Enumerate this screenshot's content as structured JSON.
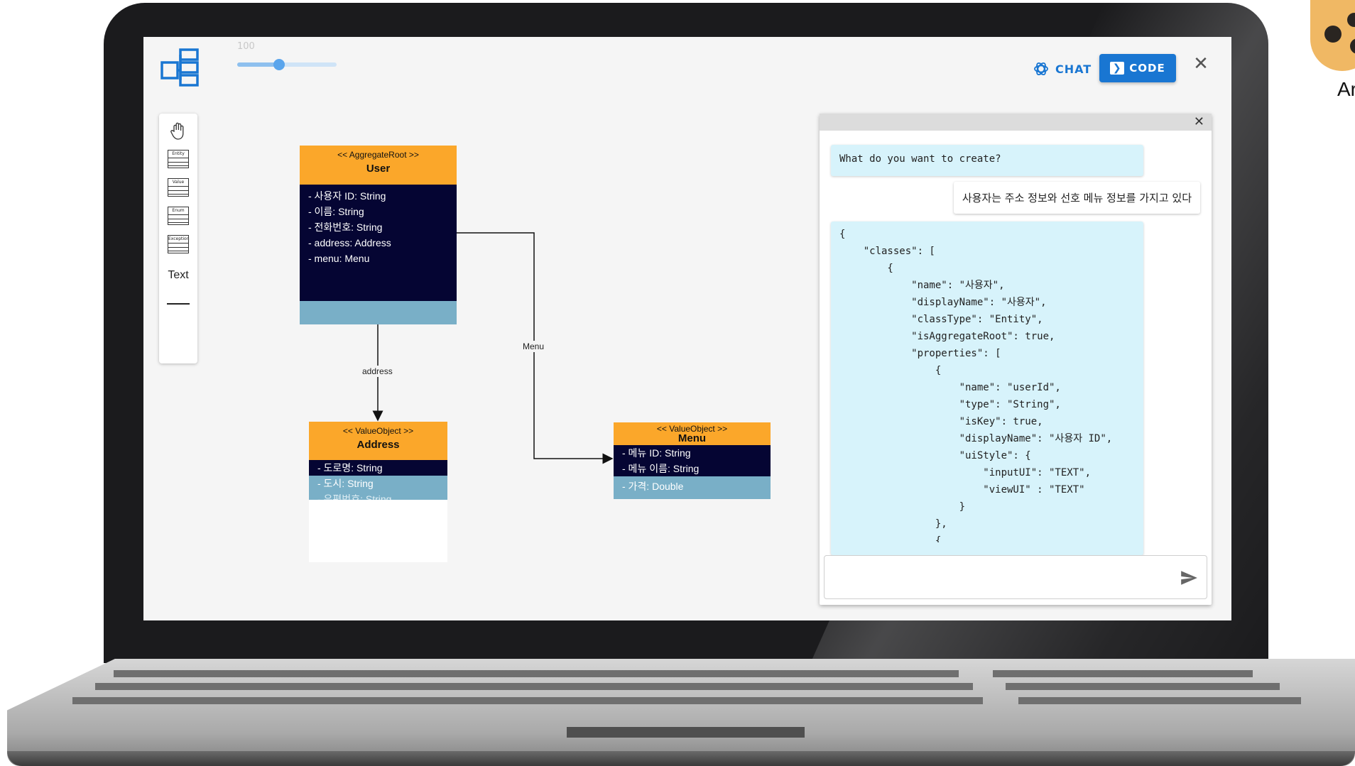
{
  "brand": {
    "side_logo_text": "Ar"
  },
  "toolbar_top": {
    "zoom_value": "100",
    "zoom_level": 0.42,
    "chat_label": "CHAT",
    "code_label": "CODE"
  },
  "palette": {
    "entity_label": "Entity",
    "value_label": "Value",
    "enum_label": "Enum",
    "exception_label": "Exception",
    "text_label": "Text"
  },
  "diagram": {
    "user": {
      "stereotype": "<< AggregateRoot >>",
      "name": "User",
      "properties": [
        "- 사용자 ID: String",
        "- 이름: String",
        "- 전화번호: String",
        "- address: Address",
        "- menu: Menu"
      ]
    },
    "address": {
      "stereotype": "<< ValueObject >>",
      "name": "Address",
      "properties": [
        "- 도로명: String",
        "- 도시: String",
        "- 우편번호: String"
      ]
    },
    "menu": {
      "stereotype": "<< ValueObject >>",
      "name": "Menu",
      "properties": [
        "- 메뉴 ID: String",
        "- 메뉴 이름: String",
        "- 가격: Double"
      ]
    },
    "edges": {
      "address_label": "address",
      "menu_label": "Menu"
    }
  },
  "chat": {
    "assistant_prompt": "What do you want to create?",
    "user_message": "사용자는 주소 정보와 선호 메뉴 정보를 가지고 있다",
    "code_response": "{\n    \"classes\": [\n        {\n            \"name\": \"사용자\",\n            \"displayName\": \"사용자\",\n            \"classType\": \"Entity\",\n            \"isAggregateRoot\": true,\n            \"properties\": [\n                {\n                    \"name\": \"userId\",\n                    \"type\": \"String\",\n                    \"isKey\": true,\n                    \"displayName\": \"사용자 ID\",\n                    \"uiStyle\": {\n                        \"inputUI\": \"TEXT\",\n                        \"viewUI\" : \"TEXT\"\n                    }\n                },\n                {",
    "input_value": ""
  },
  "colors": {
    "primary": "#1976d2",
    "uml_head": "#fba72a",
    "uml_body": "#050533",
    "uml_foot": "#79afc7",
    "chat_bubble": "#d7f3fb"
  }
}
